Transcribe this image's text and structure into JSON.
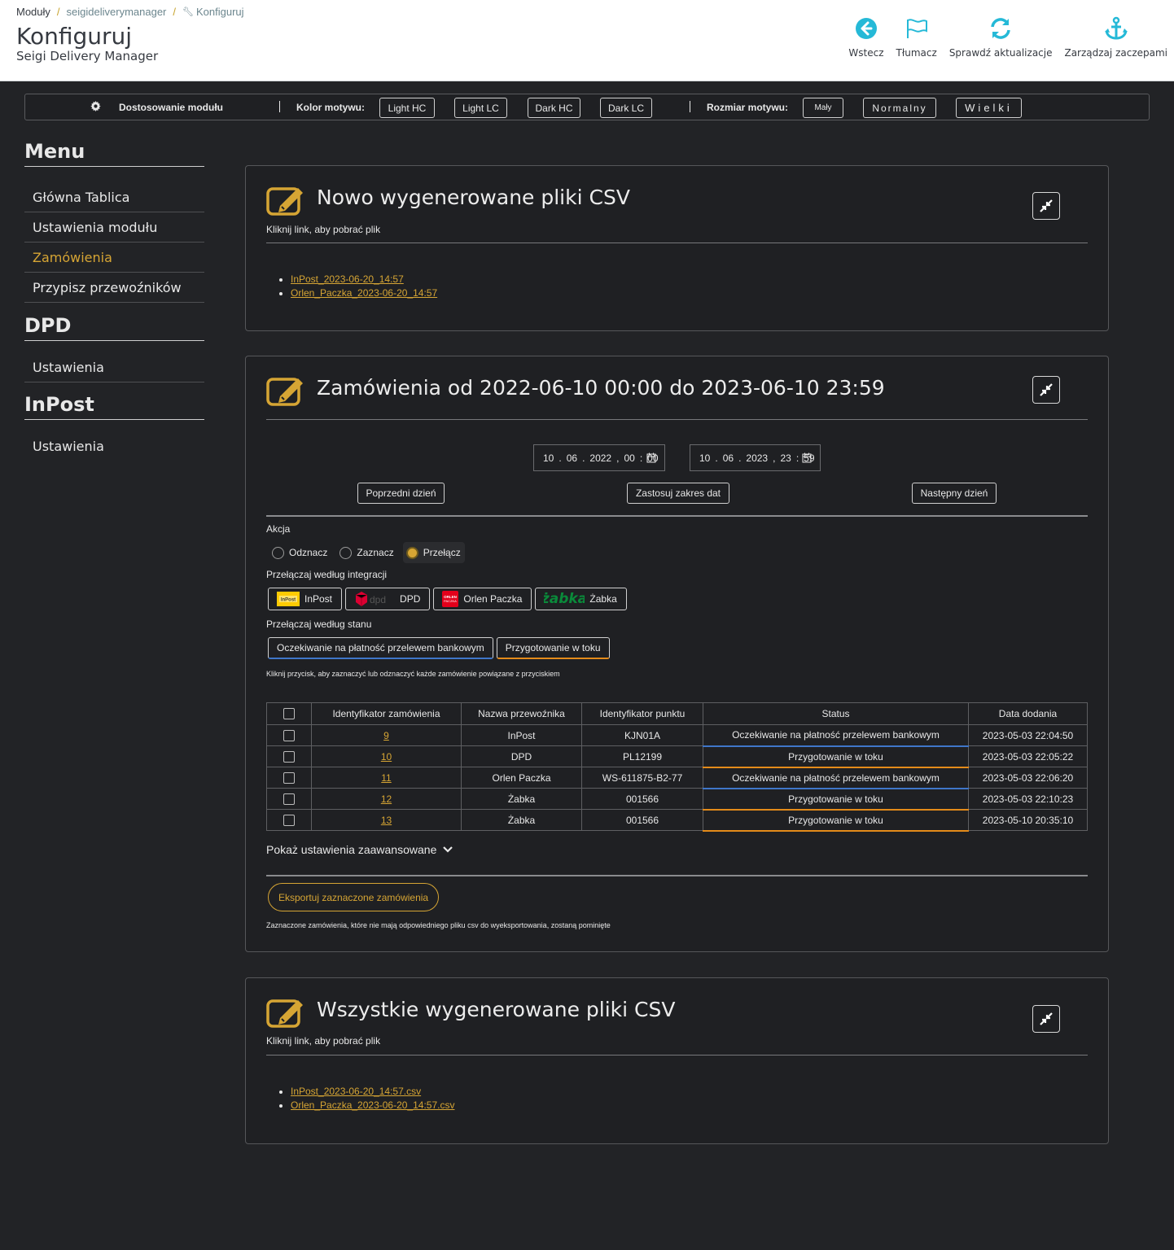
{
  "header": {
    "breadcrumb": [
      "Moduły",
      "seigideliverymanager",
      "Konfiguruj"
    ],
    "title": "Konfiguruj",
    "subtitle": "Seigi Delivery Manager",
    "toolbar": [
      {
        "label": "Wstecz",
        "icon": "arrow-left-circle-icon"
      },
      {
        "label": "Tłumacz",
        "icon": "flag-icon"
      },
      {
        "label": "Sprawdź aktualizacje",
        "icon": "refresh-icon"
      },
      {
        "label": "Zarządzaj zaczepami",
        "icon": "anchor-icon"
      }
    ]
  },
  "customizer": {
    "module_label": "Dostosowanie modułu",
    "color_label": "Kolor motywu:",
    "colors": [
      "Light HC",
      "Light LC",
      "Dark HC",
      "Dark LC"
    ],
    "size_label": "Rozmiar motywu:",
    "sizes": [
      "Mały",
      "Normalny",
      "Wielki"
    ]
  },
  "sidebar": {
    "sections": [
      {
        "title": "Menu",
        "items": [
          "Główna Tablica",
          "Ustawienia modułu",
          "Zamówienia",
          "Przypisz przewoźników"
        ],
        "active": 2
      },
      {
        "title": "DPD",
        "items": [
          "Ustawienia"
        ]
      },
      {
        "title": "InPost",
        "items": [
          "Ustawienia"
        ]
      }
    ]
  },
  "panel_new": {
    "title": "Nowo wygenerowane pliki CSV",
    "subtitle": "Kliknij link, aby pobrać plik",
    "files": [
      "InPost_2023-06-20_14:57",
      "Orlen_Paczka_2023-06-20_14:57"
    ]
  },
  "panel_orders": {
    "title": "Zamówienia od 2022-06-10 00:00 do 2023-06-10 23:59",
    "date_from": {
      "day": "10",
      "month": "06",
      "year": "2022",
      "hour": "00",
      "minute": "00"
    },
    "date_to": {
      "day": "10",
      "month": "06",
      "year": "2023",
      "hour": "23",
      "minute": "59"
    },
    "prev_day": "Poprzedni dzień",
    "apply_range": "Zastosuj zakres dat",
    "next_day": "Następny dzień",
    "action_label": "Akcja",
    "actions": [
      "Odznacz",
      "Zaznacz",
      "Przełącz"
    ],
    "selected_action": "Przełącz",
    "by_integration_label": "Przełączaj według integracji",
    "integrations": [
      "InPost",
      "DPD",
      "Orlen Paczka",
      "Żabka"
    ],
    "by_state_label": "Przełączaj według stanu",
    "states": [
      "Oczekiwanie na płatność przelewem bankowym",
      "Przygotowanie w toku"
    ],
    "hint": "Kliknij przycisk, aby zaznaczyć lub odznaczyć każde zamówienie powiązane z przyciskiem",
    "columns": [
      "Identyfikator zamówienia",
      "Nazwa przewoźnika",
      "Identyfikator punktu",
      "Status",
      "Data dodania"
    ],
    "rows": [
      {
        "id": "9",
        "carrier": "InPost",
        "point": "KJN01A",
        "status": "Oczekiwanie na płatność przelewem bankowym",
        "date": "2023-05-03 22:04:50"
      },
      {
        "id": "10",
        "carrier": "DPD",
        "point": "PL12199",
        "status": "Przygotowanie w toku",
        "date": "2023-05-03 22:05:22"
      },
      {
        "id": "11",
        "carrier": "Orlen Paczka",
        "point": "WS-611875-B2-77",
        "status": "Oczekiwanie na płatność przelewem bankowym",
        "date": "2023-05-03 22:06:20"
      },
      {
        "id": "12",
        "carrier": "Żabka",
        "point": "001566",
        "status": "Przygotowanie w toku",
        "date": "2023-05-03 22:10:23"
      },
      {
        "id": "13",
        "carrier": "Żabka",
        "point": "001566",
        "status": "Przygotowanie w toku",
        "date": "2023-05-10 20:35:10"
      }
    ],
    "advanced_label": "Pokaż ustawienia zaawansowane",
    "export_label": "Eksportuj zaznaczone zamówienia",
    "export_note": "Zaznaczone zamówienia, które nie mają odpowiedniego pliku csv do wyeksportowania, zostaną pominięte"
  },
  "panel_all": {
    "title": "Wszystkie wygenerowane pliki CSV",
    "subtitle": "Kliknij link, aby pobrać plik",
    "files": [
      "InPost_2023-06-20_14:57.csv",
      "Orlen_Paczka_2023-06-20_14:57.csv"
    ]
  },
  "colors": {
    "accent": "#d6a534",
    "background": "#222326",
    "status_blue": "#3f76c9",
    "status_orange": "#e48b1a",
    "link_blue": "#25b9d7"
  }
}
